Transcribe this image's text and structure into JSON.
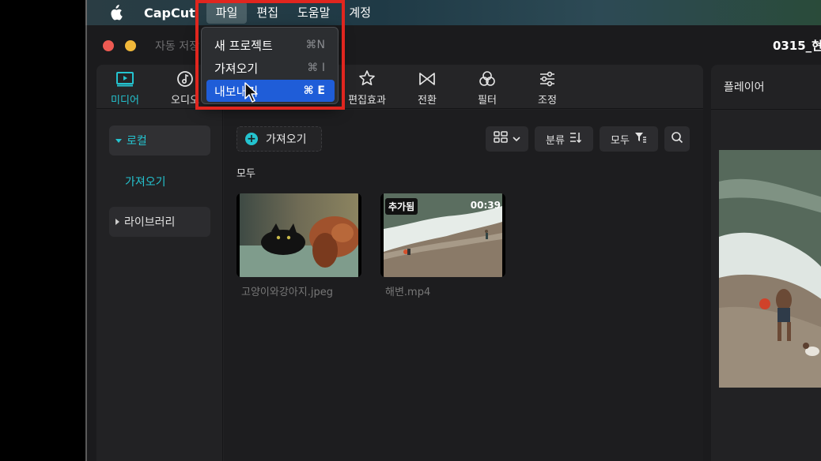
{
  "menubar": {
    "app_name": "CapCut",
    "items": [
      "파일",
      "편집",
      "도움말",
      "계정"
    ]
  },
  "window": {
    "title_left": "자동 저장",
    "title_right": "0315_현"
  },
  "toolbar": {
    "tools": [
      {
        "label": "미디어",
        "icon": "media-icon"
      },
      {
        "label": "오디오",
        "icon": "audio-icon"
      },
      {
        "label": "편집효과",
        "icon": "effects-icon"
      },
      {
        "label": "전환",
        "icon": "transition-icon"
      },
      {
        "label": "필터",
        "icon": "filter-icon"
      },
      {
        "label": "조정",
        "icon": "adjust-icon"
      }
    ]
  },
  "sidebar": {
    "local": "로컬",
    "import": "가져오기",
    "library": "라이브러리"
  },
  "content": {
    "import_button": "가져오기",
    "view_toggle_icon": "grid-icon",
    "sort_label": "분류",
    "filter_label": "모두",
    "section_label": "모두",
    "media": [
      {
        "name": "고양이와강아지.jpeg"
      },
      {
        "name": "해변.mp4",
        "badge": "추가됨",
        "duration": "00:39"
      }
    ]
  },
  "player": {
    "title": "플레이어"
  },
  "file_menu": {
    "items": [
      {
        "label": "새 프로젝트",
        "shortcut": "⌘N"
      },
      {
        "label": "가져오기",
        "shortcut": "⌘ I"
      },
      {
        "label": "내보내기",
        "shortcut": "⌘ E"
      }
    ]
  },
  "colors": {
    "accent": "#24c3cf",
    "highlight": "#1f5dd8",
    "annotation": "#e0261f"
  }
}
